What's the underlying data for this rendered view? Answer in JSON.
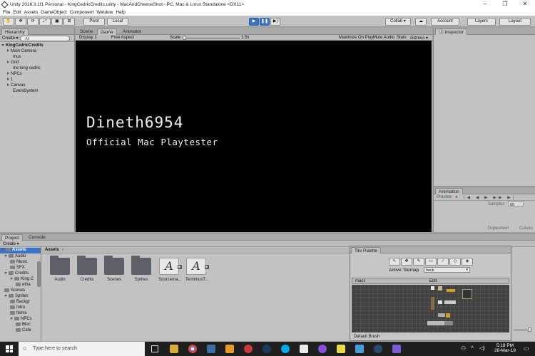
{
  "window": {
    "title": "Unity 2018.3.1f1 Personal - KingCedricCredits.unity - MacAndCheeseShot - PC, Mac & Linux Standalone <DX11>",
    "minimize": "–",
    "maximize": "❐",
    "close": "✕"
  },
  "menu": [
    "File",
    "Edit",
    "Assets",
    "GameObject",
    "Component",
    "Window",
    "Help"
  ],
  "toolbar": {
    "pivot": "Pivot",
    "local": "Local",
    "collab": "Collab ▾",
    "account": "Account",
    "layers": "Layers",
    "layout": "Layout"
  },
  "hierarchy": {
    "tab": "Hierarchy",
    "create": "Create ▾",
    "search": "All",
    "scene": "KingCedricCredits",
    "items": [
      "Main Camera",
      "mus",
      "Grid",
      "me king cedric",
      "NPCs",
      "1",
      "Canvas",
      "EventSystem"
    ]
  },
  "scene_tabs": {
    "scene": "Scene",
    "game": "Game",
    "animator": "Animator"
  },
  "game_bar": {
    "display": "Display 1",
    "aspect": "Free Aspect",
    "scale_label": "Scale",
    "scale_value": "1.5x",
    "maximize": "Maximize On Play",
    "mute": "Mute Audio",
    "stats": "Stats",
    "gizmos": "Gizmos ▾"
  },
  "game_view": {
    "name": "Dineth6954",
    "subtitle": "Official Mac Playtester"
  },
  "inspector": {
    "tab": "Inspector"
  },
  "animation": {
    "tab": "Animation",
    "preview": "Preview",
    "samples_label": "Samples",
    "samples_value": "60",
    "dopesheet": "Dopesheet",
    "curves": "Curves"
  },
  "project": {
    "tab": "Project",
    "console": "Console",
    "create": "Create ▾",
    "favorites_root": "Assets",
    "path": "Assets",
    "tree": [
      "Audio",
      "Music",
      "SFX",
      "Credits",
      "King C",
      "etha",
      "Scenes",
      "Sprites",
      "Backgr",
      "Intro",
      "Items",
      "NPCs",
      "Bloc",
      "Cafe"
    ],
    "assets": [
      "Audio",
      "Credits",
      "Scenes",
      "Sprites",
      "Sourcema...",
      "TerminusT..."
    ]
  },
  "tile_palette": {
    "tab": "Tile Palette",
    "active_tilemap_label": "Active Tilemap",
    "active_tilemap": "heck",
    "palette": "macs",
    "edit": "Edit",
    "brush": "Default Brush"
  },
  "taskbar": {
    "search": "Type here to search",
    "time": "5:18 PM",
    "date": "28-Mar-19"
  },
  "colors": {
    "game_bg": "#000000",
    "taskbar": "#1f1f1f",
    "play_accent": "#3d73c4"
  }
}
